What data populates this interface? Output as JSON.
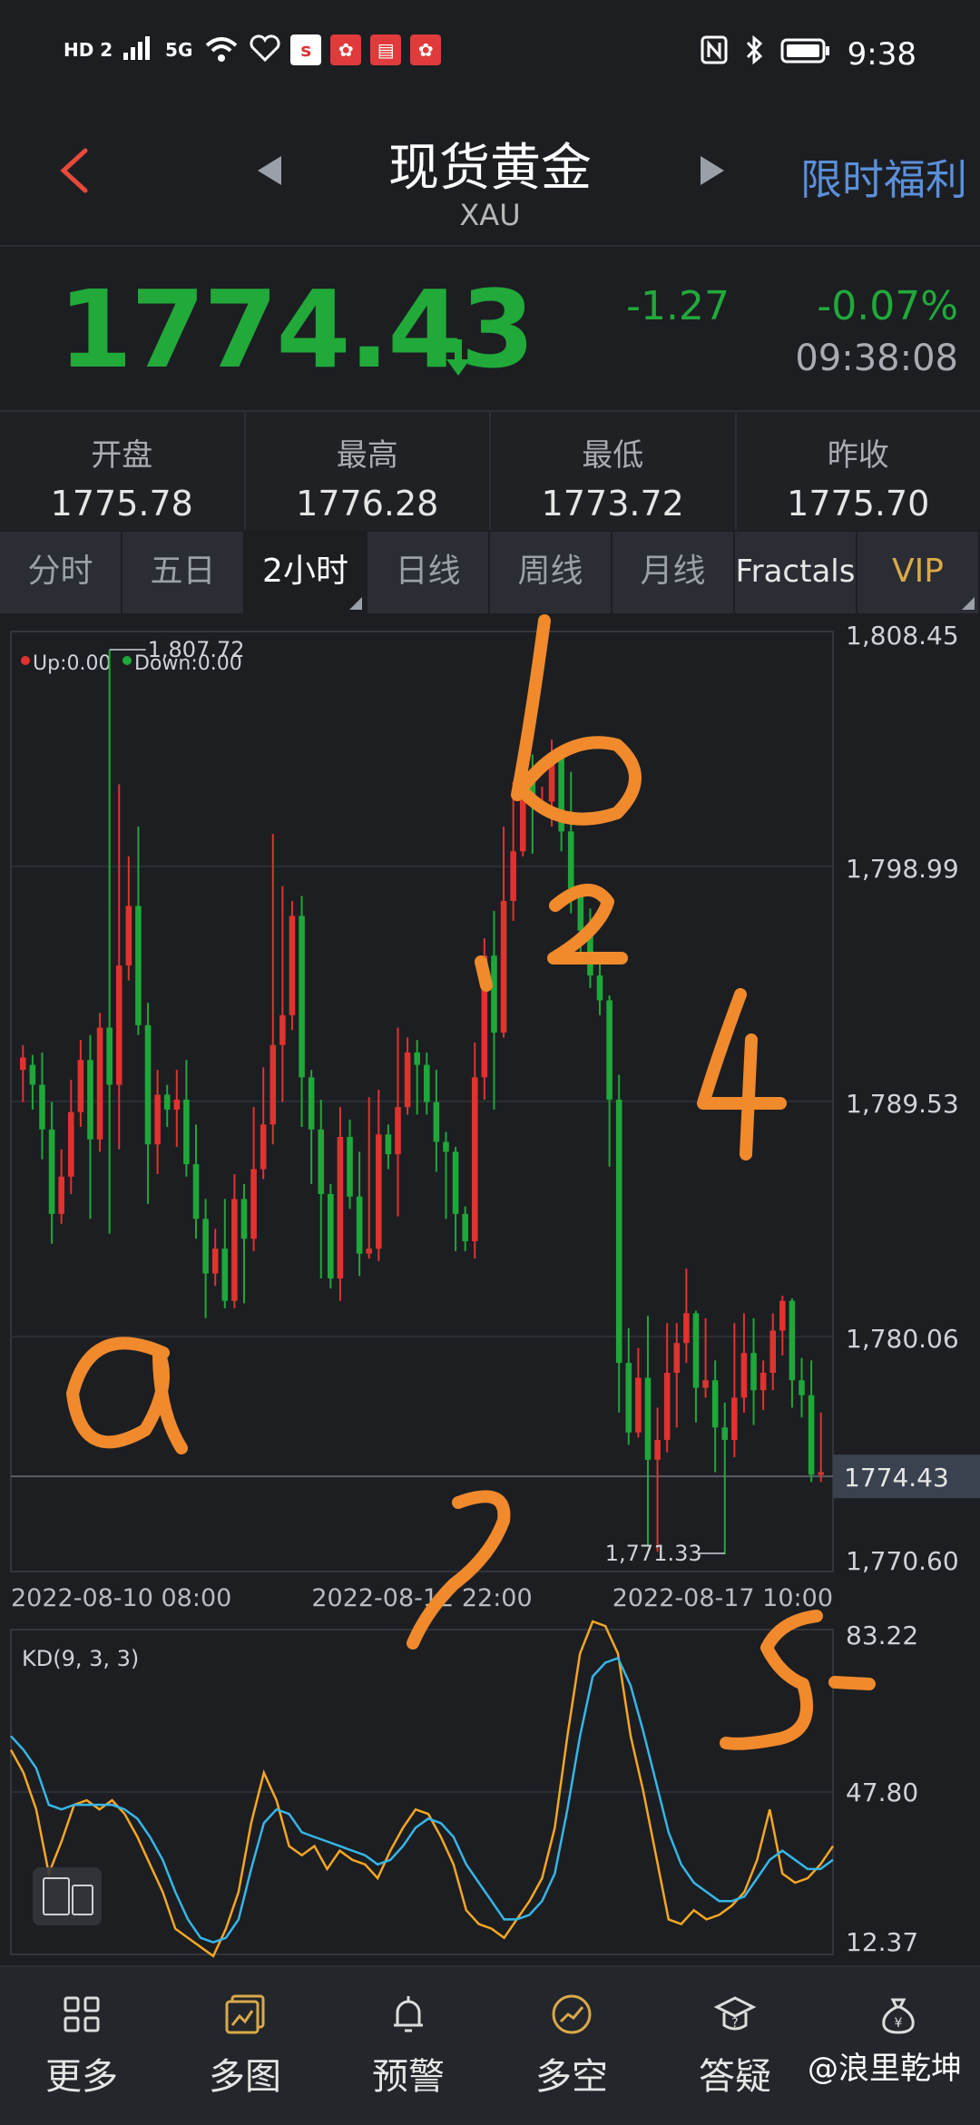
{
  "status_bar": {
    "left_icons": [
      "HD 2",
      "5G",
      "wifi-icon",
      "heart-icon",
      "sina-icon",
      "app-icon",
      "book-icon",
      "app-icon"
    ],
    "time": "9:38"
  },
  "header": {
    "title": "现货黄金",
    "subtitle": "XAU",
    "promo": "限时福利"
  },
  "quote": {
    "price": "1774.43",
    "change": "-1.27",
    "change_pct": "-0.07%",
    "time": "09:38:08"
  },
  "stats": [
    {
      "label": "开盘",
      "value": "1775.78"
    },
    {
      "label": "最高",
      "value": "1776.28"
    },
    {
      "label": "最低",
      "value": "1773.72"
    },
    {
      "label": "昨收",
      "value": "1775.70"
    }
  ],
  "tabs": [
    "分时",
    "五日",
    "2小时",
    "日线",
    "周线",
    "月线",
    "Fractals",
    "VIP"
  ],
  "active_tab": "2小时",
  "colors": {
    "up": "#e0332f",
    "down": "#1fa83a",
    "k_line": "#f5a623",
    "d_line": "#36b6e6",
    "accent": "#5b8fd9",
    "vip": "#d9a94a"
  },
  "chart_data": [
    {
      "type": "candlestick",
      "legend": {
        "up": "Up:0.00",
        "down": "Down:0.00"
      },
      "y_ticks": [
        "1,808.45",
        "1,798.99",
        "1,789.53",
        "1,780.06",
        "1,770.60"
      ],
      "ylim": [
        1770.6,
        1808.45
      ],
      "x_ticks": [
        "2022-08-10 08:00",
        "2022-08-12 22:00",
        "2022-08-17 10:00"
      ],
      "current_price_label": "1774.43",
      "current_price": 1774.43,
      "annotations": [
        {
          "text": "1,807.72",
          "value": 1807.72,
          "index": 9
        },
        {
          "text": "1,771.33",
          "value": 1771.33,
          "index": 73
        }
      ],
      "candles": [
        [
          1790.8,
          1791.3,
          1789.5,
          1791.8
        ],
        [
          1791.0,
          1790.2,
          1789.2,
          1791.4
        ],
        [
          1790.2,
          1788.4,
          1787.2,
          1791.5
        ],
        [
          1788.4,
          1785.0,
          1783.8,
          1789.5
        ],
        [
          1785.0,
          1786.5,
          1784.6,
          1787.6
        ],
        [
          1786.5,
          1789.1,
          1785.8,
          1790.4
        ],
        [
          1789.1,
          1791.2,
          1788.5,
          1792.0
        ],
        [
          1791.2,
          1788.0,
          1784.8,
          1792.2
        ],
        [
          1788.0,
          1792.5,
          1787.5,
          1793.1
        ],
        [
          1792.5,
          1790.2,
          1784.2,
          1807.7
        ],
        [
          1790.2,
          1795.0,
          1787.6,
          1802.3
        ],
        [
          1795.0,
          1797.4,
          1794.4,
          1799.4
        ],
        [
          1797.4,
          1792.6,
          1792.2,
          1800.6
        ],
        [
          1792.6,
          1787.8,
          1785.4,
          1793.5
        ],
        [
          1787.8,
          1789.8,
          1786.6,
          1790.8
        ],
        [
          1789.8,
          1789.2,
          1788.5,
          1790.2
        ],
        [
          1789.2,
          1789.6,
          1787.7,
          1790.8
        ],
        [
          1789.6,
          1787.0,
          1786.5,
          1791.2
        ],
        [
          1787.0,
          1784.8,
          1784.0,
          1788.6
        ],
        [
          1784.8,
          1782.6,
          1780.8,
          1785.6
        ],
        [
          1782.6,
          1783.6,
          1782.1,
          1784.4
        ],
        [
          1783.6,
          1781.5,
          1781.2,
          1785.6
        ],
        [
          1781.5,
          1785.6,
          1781.2,
          1786.6
        ],
        [
          1785.6,
          1784.0,
          1781.4,
          1786.2
        ],
        [
          1784.0,
          1786.8,
          1783.5,
          1789.3
        ],
        [
          1786.8,
          1788.6,
          1786.4,
          1790.9
        ],
        [
          1788.6,
          1791.8,
          1787.8,
          1800.3
        ],
        [
          1791.8,
          1793.0,
          1789.5,
          1798.2
        ],
        [
          1793.0,
          1797.0,
          1792.4,
          1797.6
        ],
        [
          1797.0,
          1790.5,
          1788.5,
          1797.8
        ],
        [
          1790.5,
          1788.4,
          1786.2,
          1790.8
        ],
        [
          1788.4,
          1785.8,
          1782.4,
          1789.6
        ],
        [
          1785.8,
          1782.4,
          1782.0,
          1786.2
        ],
        [
          1782.4,
          1788.1,
          1781.5,
          1789.3
        ],
        [
          1788.1,
          1785.7,
          1785.2,
          1788.8
        ],
        [
          1785.7,
          1783.4,
          1782.5,
          1787.5
        ],
        [
          1783.4,
          1783.6,
          1783.2,
          1789.7
        ],
        [
          1783.6,
          1788.2,
          1783.1,
          1790.0
        ],
        [
          1788.2,
          1787.4,
          1786.8,
          1788.6
        ],
        [
          1787.4,
          1789.3,
          1784.9,
          1792.5
        ],
        [
          1789.3,
          1791.5,
          1789.0,
          1792.1
        ],
        [
          1791.5,
          1791.0,
          1789.0,
          1792.0
        ],
        [
          1791.0,
          1789.5,
          1789.0,
          1791.5
        ],
        [
          1789.5,
          1787.9,
          1786.7,
          1790.8
        ],
        [
          1787.9,
          1787.5,
          1784.8,
          1788.3
        ],
        [
          1787.5,
          1785.0,
          1783.5,
          1787.7
        ],
        [
          1785.0,
          1783.9,
          1783.5,
          1785.3
        ],
        [
          1783.9,
          1790.5,
          1783.2,
          1791.9
        ],
        [
          1790.5,
          1795.4,
          1789.6,
          1796.1
        ],
        [
          1795.4,
          1792.3,
          1789.2,
          1797.2
        ],
        [
          1792.3,
          1797.6,
          1792.1,
          1800.6
        ],
        [
          1797.6,
          1799.6,
          1796.8,
          1802.4
        ],
        [
          1799.6,
          1802.9,
          1799.4,
          1804.0
        ],
        [
          1802.9,
          1801.4,
          1799.5,
          1803.5
        ],
        [
          1801.4,
          1801.6,
          1801.1,
          1802.2
        ],
        [
          1801.6,
          1803.4,
          1800.6,
          1804.1
        ],
        [
          1803.4,
          1800.4,
          1799.6,
          1803.7
        ],
        [
          1800.4,
          1798.1,
          1797.1,
          1802.8
        ],
        [
          1798.1,
          1796.4,
          1795.2,
          1797.3
        ],
        [
          1796.4,
          1794.6,
          1794.1,
          1797.3
        ],
        [
          1794.6,
          1793.6,
          1793.0,
          1795.5
        ],
        [
          1793.6,
          1789.6,
          1786.9,
          1793.8
        ],
        [
          1789.6,
          1779.0,
          1777.0,
          1790.6
        ],
        [
          1779.0,
          1776.2,
          1775.7,
          1780.4
        ],
        [
          1776.2,
          1778.4,
          1776.0,
          1779.6
        ],
        [
          1778.4,
          1775.1,
          1771.6,
          1780.9
        ],
        [
          1775.1,
          1775.9,
          1771.4,
          1777.2
        ],
        [
          1775.9,
          1778.6,
          1775.4,
          1780.6
        ],
        [
          1778.6,
          1779.8,
          1776.4,
          1780.6
        ],
        [
          1779.8,
          1781.0,
          1779.0,
          1782.8
        ],
        [
          1781.0,
          1778.0,
          1776.6,
          1781.1
        ],
        [
          1778.0,
          1778.3,
          1777.6,
          1780.8
        ],
        [
          1778.3,
          1776.4,
          1774.6,
          1779.1
        ],
        [
          1776.4,
          1775.9,
          1771.3,
          1777.4
        ],
        [
          1775.9,
          1777.6,
          1775.2,
          1780.6
        ],
        [
          1777.6,
          1779.4,
          1777.0,
          1781.0
        ],
        [
          1779.4,
          1777.9,
          1776.5,
          1780.8
        ],
        [
          1777.9,
          1778.6,
          1777.1,
          1779.1
        ],
        [
          1778.6,
          1780.3,
          1777.9,
          1781.0
        ],
        [
          1780.3,
          1781.5,
          1779.3,
          1781.7
        ],
        [
          1781.5,
          1778.3,
          1777.2,
          1781.6
        ],
        [
          1778.3,
          1777.7,
          1776.8,
          1779.2
        ],
        [
          1777.7,
          1774.5,
          1774.2,
          1779.1
        ],
        [
          1774.5,
          1774.6,
          1774.2,
          1777.0
        ]
      ]
    },
    {
      "type": "line",
      "title": "KD(9, 3, 3)",
      "y_ticks": [
        "83.22",
        "47.80",
        "12.37"
      ],
      "ylim": [
        12.37,
        83.22
      ],
      "series": [
        {
          "name": "K",
          "color": "#f5a623",
          "values": [
            57,
            52,
            44,
            30,
            37,
            45,
            46,
            44,
            46,
            43,
            38,
            32,
            26,
            18,
            16,
            14,
            12,
            18,
            26,
            41,
            52,
            46,
            36,
            34,
            36,
            31,
            35,
            33,
            32,
            29,
            35,
            40,
            44,
            43,
            38,
            32,
            22,
            19,
            18,
            16,
            20,
            24,
            29,
            40,
            60,
            78,
            85,
            84,
            78,
            60,
            48,
            34,
            20,
            19,
            22,
            20,
            21,
            23,
            26,
            33,
            44,
            30,
            28,
            29,
            32,
            36
          ]
        },
        {
          "name": "D",
          "color": "#36b6e6",
          "values": [
            60,
            57,
            53,
            45,
            44,
            45,
            45,
            45,
            45,
            44,
            42,
            38,
            33,
            26,
            20,
            16,
            15,
            16,
            20,
            31,
            41,
            44,
            43,
            39,
            38,
            37,
            36,
            35,
            34,
            32,
            33,
            36,
            40,
            42,
            41,
            38,
            32,
            28,
            24,
            20,
            20,
            21,
            24,
            30,
            44,
            60,
            73,
            76,
            77,
            71,
            61,
            50,
            39,
            32,
            28,
            26,
            24,
            24,
            25,
            29,
            33,
            35,
            33,
            31,
            31,
            33
          ]
        }
      ]
    }
  ],
  "bottom_nav": [
    {
      "label": "更多",
      "icon": "grid-icon"
    },
    {
      "label": "多图",
      "icon": "chart-icon"
    },
    {
      "label": "预警",
      "icon": "bell-icon"
    },
    {
      "label": "多空",
      "icon": "trend-icon"
    },
    {
      "label": "答疑",
      "icon": "hat-icon"
    },
    {
      "label": "",
      "icon": "money-bag-icon"
    }
  ],
  "watermark": "@浪里乾坤"
}
